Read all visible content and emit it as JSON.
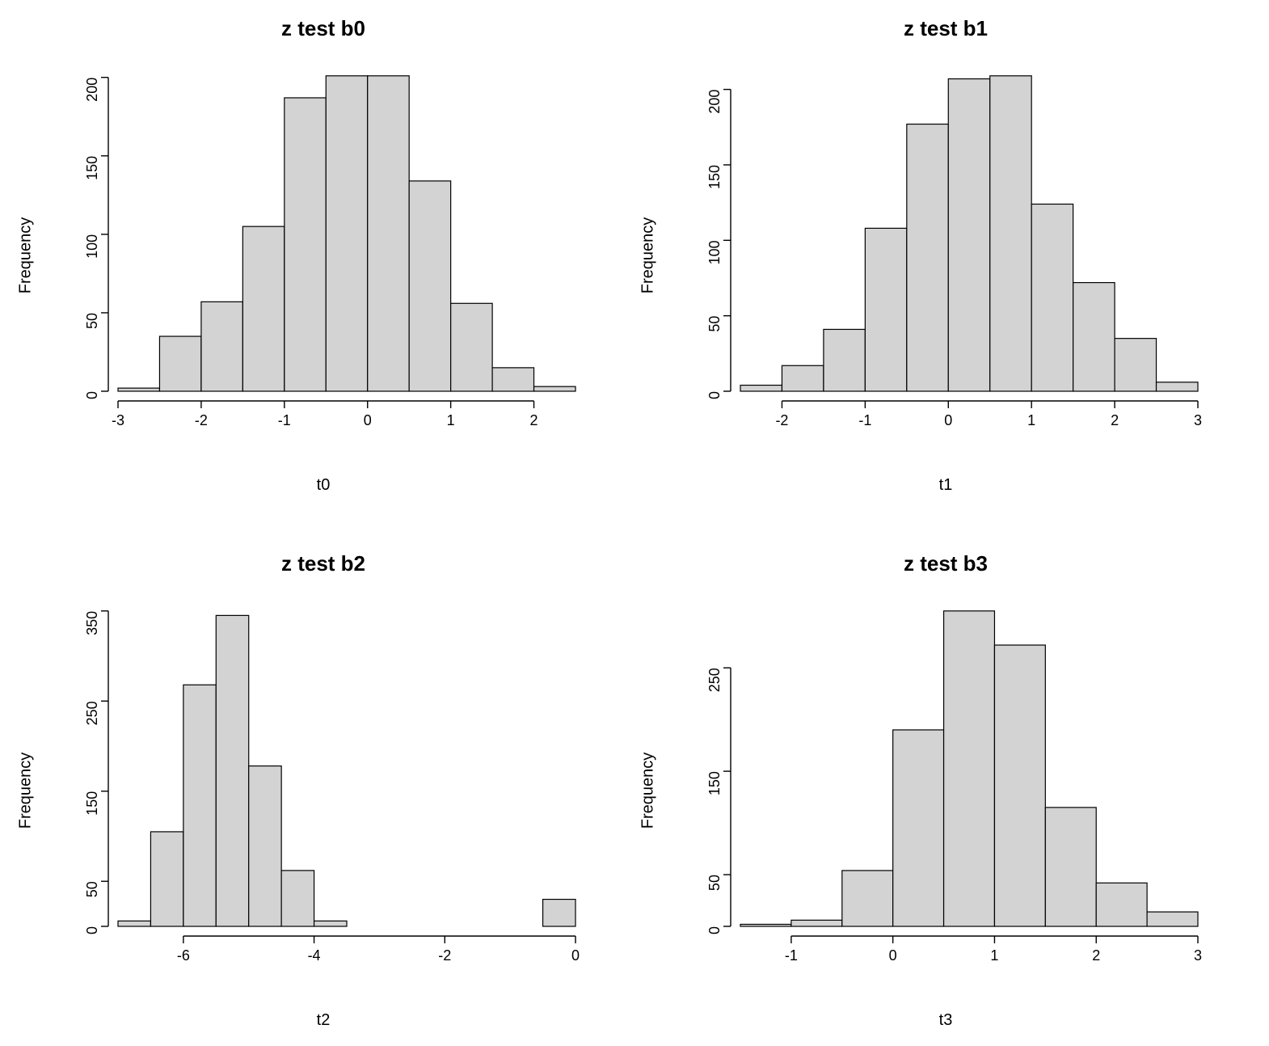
{
  "chart_data": [
    {
      "id": "b0",
      "type": "bar",
      "title": "z test b0",
      "xlabel": "t0",
      "ylabel": "Frequency",
      "bin_width": 0.5,
      "bin_edges": [
        -3.0,
        -2.5,
        -2.0,
        -1.5,
        -1.0,
        -0.5,
        0.0,
        0.5,
        1.0,
        1.5,
        2.0,
        2.5
      ],
      "values": [
        2,
        35,
        57,
        105,
        187,
        201,
        201,
        134,
        56,
        15,
        3
      ],
      "xlim": [
        -3,
        2.5
      ],
      "ylim": [
        0,
        200
      ],
      "x_ticks": [
        -3,
        -2,
        -1,
        0,
        1,
        2
      ],
      "y_ticks": [
        0,
        50,
        100,
        150,
        200
      ]
    },
    {
      "id": "b1",
      "type": "bar",
      "title": "z test b1",
      "xlabel": "t1",
      "ylabel": "Frequency",
      "bin_width": 0.5,
      "bin_edges": [
        -2.5,
        -2.0,
        -1.5,
        -1.0,
        -0.5,
        0.0,
        0.5,
        1.0,
        1.5,
        2.0,
        2.5,
        3.0
      ],
      "values": [
        4,
        17,
        41,
        108,
        177,
        207,
        209,
        124,
        72,
        35,
        6
      ],
      "xlim": [
        -2.5,
        3.0
      ],
      "ylim": [
        0,
        200
      ],
      "x_ticks": [
        -2,
        -1,
        0,
        1,
        2,
        3
      ],
      "y_ticks": [
        0,
        50,
        100,
        150,
        200
      ]
    },
    {
      "id": "b2",
      "type": "bar",
      "title": "z test b2",
      "xlabel": "t2",
      "ylabel": "Frequency",
      "bin_width": 0.5,
      "bin_edges": [
        -7.0,
        -6.5,
        -6.0,
        -5.5,
        -5.0,
        -4.5,
        -4.0,
        -3.5,
        -3.0,
        -2.5,
        -2.0,
        -1.5,
        -1.0,
        -0.5,
        0.0
      ],
      "values": [
        6,
        105,
        268,
        345,
        178,
        62,
        6,
        0,
        0,
        0,
        0,
        0,
        0,
        30
      ],
      "xlim": [
        -7.0,
        0.0
      ],
      "ylim": [
        0,
        350
      ],
      "x_ticks": [
        -6,
        -4,
        -2,
        0
      ],
      "y_ticks": [
        0,
        50,
        150,
        250,
        350
      ]
    },
    {
      "id": "b3",
      "type": "bar",
      "title": "z test b3",
      "xlabel": "t3",
      "ylabel": "Frequency",
      "bin_width": 0.5,
      "bin_edges": [
        -1.5,
        -1.0,
        -0.5,
        0.0,
        0.5,
        1.0,
        1.5,
        2.0,
        2.5,
        3.0
      ],
      "values": [
        2,
        6,
        54,
        190,
        305,
        272,
        115,
        42,
        14
      ],
      "xlim": [
        -1.5,
        3.0
      ],
      "ylim": [
        0,
        300
      ],
      "x_ticks": [
        -1,
        0,
        1,
        2,
        3
      ],
      "y_ticks": [
        0,
        50,
        150,
        250
      ]
    }
  ]
}
